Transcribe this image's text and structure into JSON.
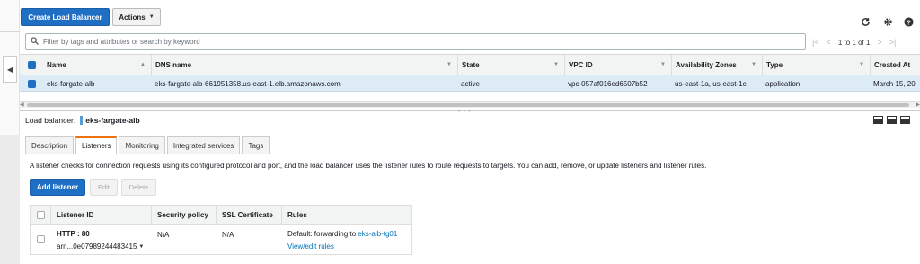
{
  "toolbar": {
    "create_label": "Create Load Balancer",
    "actions_label": "Actions",
    "refresh_icon": "refresh-icon",
    "settings_icon": "gear-icon",
    "help_icon": "help-icon"
  },
  "search": {
    "placeholder": "Filter by tags and attributes or search by keyword"
  },
  "pager": {
    "summary": "1 to 1 of 1"
  },
  "grid": {
    "columns": [
      "Name",
      "DNS name",
      "State",
      "VPC ID",
      "Availability Zones",
      "Type",
      "Created At"
    ],
    "rows": [
      {
        "name": "eks-fargate-alb",
        "dns": "eks-fargate-alb-661951358.us-east-1.elb.amazonaws.com",
        "state": "active",
        "vpc": "vpc-057af016ed6507b52",
        "zones": "us-east-1a, us-east-1c",
        "type": "application",
        "created": "March 15, 20"
      }
    ]
  },
  "details": {
    "label": "Load balancer:",
    "name": "eks-fargate-alb"
  },
  "tabs": [
    "Description",
    "Listeners",
    "Monitoring",
    "Integrated services",
    "Tags"
  ],
  "active_tab": "Listeners",
  "listeners": {
    "description": "A listener checks for connection requests using its configured protocol and port, and the load balancer uses the listener rules to route requests to targets. You can add, remove, or update listeners and listener rules.",
    "add_label": "Add listener",
    "edit_label": "Edit",
    "delete_label": "Delete",
    "columns": [
      "Listener ID",
      "Security policy",
      "SSL Certificate",
      "Rules"
    ],
    "rows": [
      {
        "id": "HTTP : 80",
        "arn": "arn...0e07989244483415",
        "security_policy": "N/A",
        "ssl": "N/A",
        "rule_prefix": "Default:  forwarding to",
        "target_group": "eks-alb-tg01",
        "view_rules": "View/edit rules"
      }
    ]
  },
  "colors": {
    "primary": "#1f6fc5",
    "selected_row": "#ddebf7",
    "tab_accent": "#ec7211",
    "link": "#0073bb"
  }
}
